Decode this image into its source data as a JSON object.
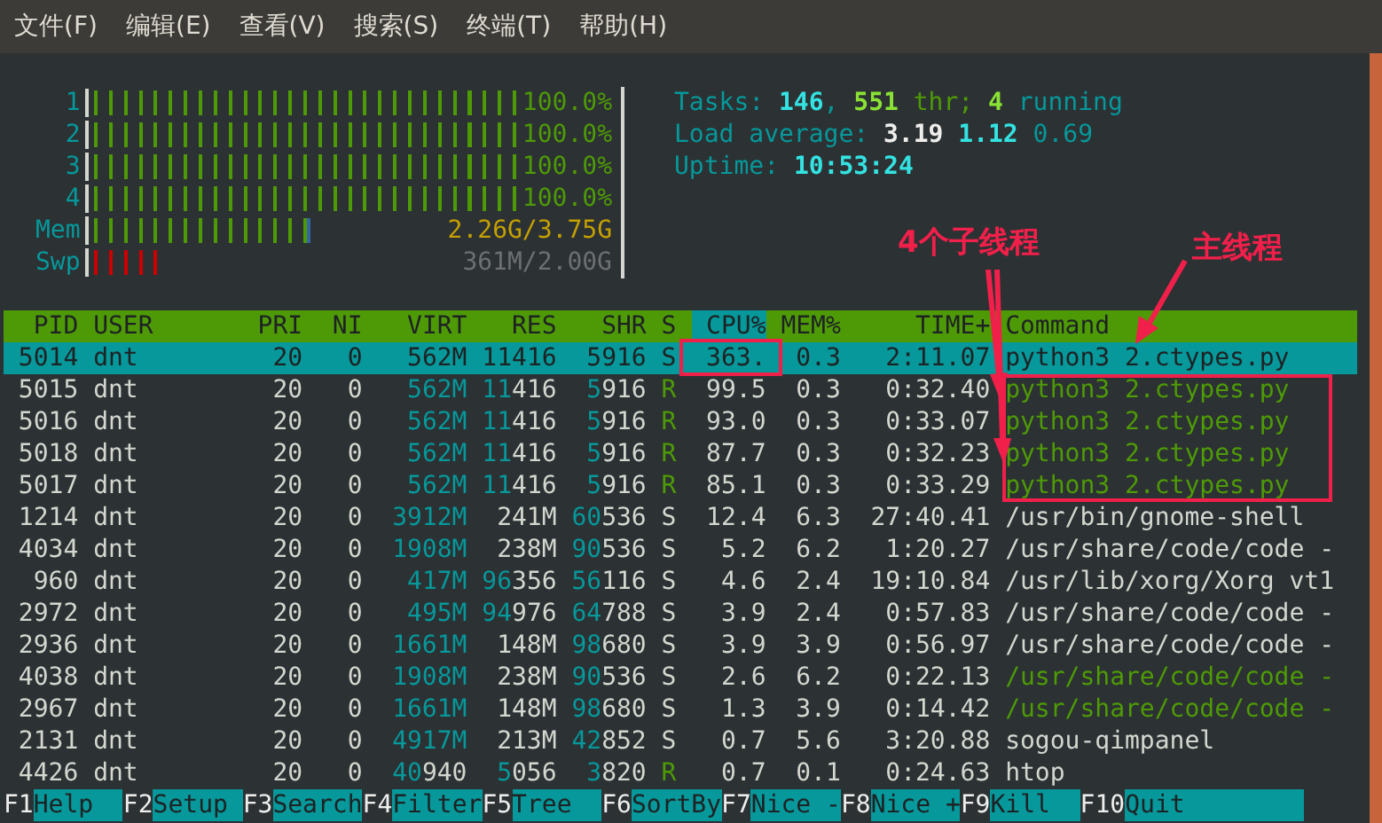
{
  "menu_bar": [
    "文件(F)",
    "编辑(E)",
    "查看(V)",
    "搜索(S)",
    "终端(T)",
    "帮助(H)"
  ],
  "meters": [
    {
      "label": "1",
      "kind": "cpu",
      "level": 1.0,
      "reading": "100.0%"
    },
    {
      "label": "2",
      "kind": "cpu",
      "level": 1.0,
      "reading": "100.0%"
    },
    {
      "label": "3",
      "kind": "cpu",
      "level": 1.0,
      "reading": "100.0%"
    },
    {
      "label": "4",
      "kind": "cpu",
      "level": 1.0,
      "reading": "100.0%"
    },
    {
      "label": "Mem",
      "kind": "mem",
      "level": 0.6,
      "reading": "2.26G/3.75G"
    },
    {
      "label": "Swp",
      "kind": "swap",
      "level": 0.18,
      "reading": "361M/2.00G"
    }
  ],
  "stats": [
    [
      {
        "text": "Tasks:",
        "kind": "label"
      },
      {
        "text": "146",
        "kind": "value"
      },
      {
        "text": ",",
        "kind": "label",
        "joined": true
      },
      {
        "text": "551",
        "kind": "value-green"
      },
      {
        "text": "thr;",
        "kind": "label-green"
      },
      {
        "text": "4",
        "kind": "value-green"
      },
      {
        "text": "running",
        "kind": "label"
      }
    ],
    [
      {
        "text": "Load average:",
        "kind": "label"
      },
      {
        "text": "3.19",
        "kind": "value-white"
      },
      {
        "text": "1.12",
        "kind": "value"
      },
      {
        "text": "0.69",
        "kind": "label"
      }
    ],
    [
      {
        "text": "Uptime:",
        "kind": "label"
      },
      {
        "text": "10:53:24",
        "kind": "value"
      }
    ]
  ],
  "columns": [
    {
      "label": "PID",
      "sorted": false
    },
    {
      "label": "USER",
      "sorted": false
    },
    {
      "label": "PRI",
      "sorted": false
    },
    {
      "label": "NI",
      "sorted": false
    },
    {
      "label": "VIRT",
      "sorted": false
    },
    {
      "label": "RES",
      "sorted": false
    },
    {
      "label": "SHR",
      "sorted": false
    },
    {
      "label": "S",
      "sorted": false
    },
    {
      "label": "CPU%",
      "sorted": true
    },
    {
      "label": "MEM%",
      "sorted": false
    },
    {
      "label": "TIME+",
      "sorted": false
    },
    {
      "label": "Command",
      "sorted": false
    }
  ],
  "processes": [
    {
      "cells": [
        "5014",
        "dnt",
        "20",
        "0",
        "562M",
        "11416",
        "5916",
        "S",
        "363.",
        "0.3",
        "2:11.07",
        "python3 2.ctypes.py"
      ],
      "selected": true,
      "running": false,
      "thread": false
    },
    {
      "cells": [
        "5015",
        "dnt",
        "20",
        "0",
        "562M",
        "11416",
        "5916",
        "R",
        "99.5",
        "0.3",
        "0:32.40",
        "python3 2.ctypes.py"
      ],
      "selected": false,
      "running": true,
      "thread": true
    },
    {
      "cells": [
        "5016",
        "dnt",
        "20",
        "0",
        "562M",
        "11416",
        "5916",
        "R",
        "93.0",
        "0.3",
        "0:33.07",
        "python3 2.ctypes.py"
      ],
      "selected": false,
      "running": true,
      "thread": true
    },
    {
      "cells": [
        "5018",
        "dnt",
        "20",
        "0",
        "562M",
        "11416",
        "5916",
        "R",
        "87.7",
        "0.3",
        "0:32.23",
        "python3 2.ctypes.py"
      ],
      "selected": false,
      "running": true,
      "thread": true
    },
    {
      "cells": [
        "5017",
        "dnt",
        "20",
        "0",
        "562M",
        "11416",
        "5916",
        "R",
        "85.1",
        "0.3",
        "0:33.29",
        "python3 2.ctypes.py"
      ],
      "selected": false,
      "running": true,
      "thread": true
    },
    {
      "cells": [
        "1214",
        "dnt",
        "20",
        "0",
        "3912M",
        "241M",
        "60536",
        "S",
        "12.4",
        "6.3",
        "27:40.41",
        "/usr/bin/gnome-shell"
      ],
      "selected": false,
      "running": false,
      "thread": false
    },
    {
      "cells": [
        "4034",
        "dnt",
        "20",
        "0",
        "1908M",
        "238M",
        "90536",
        "S",
        "5.2",
        "6.2",
        "1:20.27",
        "/usr/share/code/code -"
      ],
      "selected": false,
      "running": false,
      "thread": false
    },
    {
      "cells": [
        "960",
        "dnt",
        "20",
        "0",
        "417M",
        "96356",
        "56116",
        "S",
        "4.6",
        "2.4",
        "19:10.84",
        "/usr/lib/xorg/Xorg vt1"
      ],
      "selected": false,
      "running": false,
      "thread": false
    },
    {
      "cells": [
        "2972",
        "dnt",
        "20",
        "0",
        "495M",
        "94976",
        "64788",
        "S",
        "3.9",
        "2.4",
        "0:57.83",
        "/usr/share/code/code -"
      ],
      "selected": false,
      "running": false,
      "thread": false
    },
    {
      "cells": [
        "2936",
        "dnt",
        "20",
        "0",
        "1661M",
        "148M",
        "98680",
        "S",
        "3.9",
        "3.9",
        "0:56.97",
        "/usr/share/code/code -"
      ],
      "selected": false,
      "running": false,
      "thread": false
    },
    {
      "cells": [
        "4038",
        "dnt",
        "20",
        "0",
        "1908M",
        "238M",
        "90536",
        "S",
        "2.6",
        "6.2",
        "0:22.13",
        "/usr/share/code/code -"
      ],
      "selected": false,
      "running": false,
      "thread": true
    },
    {
      "cells": [
        "2967",
        "dnt",
        "20",
        "0",
        "1661M",
        "148M",
        "98680",
        "S",
        "1.3",
        "3.9",
        "0:14.42",
        "/usr/share/code/code -"
      ],
      "selected": false,
      "running": false,
      "thread": true
    },
    {
      "cells": [
        "2131",
        "dnt",
        "20",
        "0",
        "4917M",
        "213M",
        "42852",
        "S",
        "0.7",
        "5.6",
        "3:20.88",
        "sogou-qimpanel"
      ],
      "selected": false,
      "running": false,
      "thread": false
    },
    {
      "cells": [
        "4426",
        "dnt",
        "20",
        "0",
        "40940",
        "5056",
        "3820",
        "R",
        "0.7",
        "0.1",
        "0:24.63",
        "htop"
      ],
      "selected": false,
      "running": true,
      "thread": false
    }
  ],
  "function_keys": [
    {
      "key": "F1",
      "label": "Help"
    },
    {
      "key": "F2",
      "label": "Setup"
    },
    {
      "key": "F3",
      "label": "Search"
    },
    {
      "key": "F4",
      "label": "Filter"
    },
    {
      "key": "F5",
      "label": "Tree"
    },
    {
      "key": "F6",
      "label": "SortBy"
    },
    {
      "key": "F7",
      "label": "Nice -"
    },
    {
      "key": "F8",
      "label": "Nice +"
    },
    {
      "key": "F9",
      "label": "Kill"
    },
    {
      "key": "F10",
      "label": "Quit"
    }
  ],
  "annotations": [
    {
      "label": "4个子线程"
    },
    {
      "label": "主线程"
    }
  ]
}
